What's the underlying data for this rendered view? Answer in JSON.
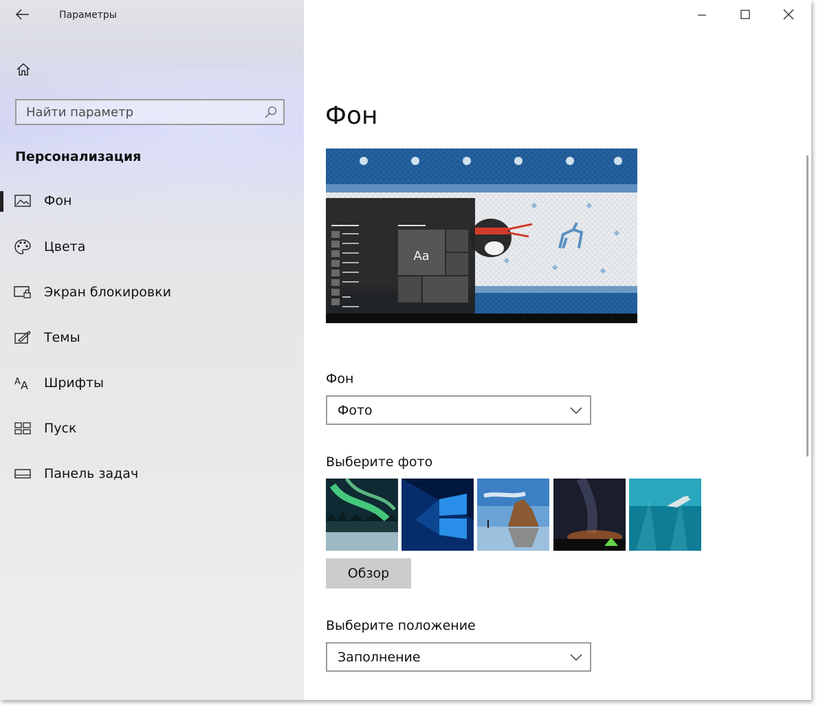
{
  "app": {
    "title": "Параметры"
  },
  "window_controls": {
    "minimize": "minimize-icon",
    "maximize": "maximize-icon",
    "close": "close-icon"
  },
  "sidebar": {
    "search_placeholder": "Найти параметр",
    "section_title": "Персонализация",
    "items": [
      {
        "label": "Фон",
        "icon": "picture-icon",
        "selected": true
      },
      {
        "label": "Цвета",
        "icon": "palette-icon",
        "selected": false
      },
      {
        "label": "Экран блокировки",
        "icon": "lock-screen-icon",
        "selected": false
      },
      {
        "label": "Темы",
        "icon": "themes-icon",
        "selected": false
      },
      {
        "label": "Шрифты",
        "icon": "fonts-icon",
        "selected": false
      },
      {
        "label": "Пуск",
        "icon": "start-icon",
        "selected": false
      },
      {
        "label": "Панель задач",
        "icon": "taskbar-icon",
        "selected": false
      }
    ]
  },
  "main": {
    "title": "Фон",
    "preview": {
      "tile_text": "Aa"
    },
    "background_label": "Фон",
    "background_value": "Фото",
    "choose_photo_label": "Выберите фото",
    "photos": [
      "aurora",
      "windows-10",
      "beach-rocks",
      "night-sky-tent",
      "underwater-swimmer"
    ],
    "browse_label": "Обзор",
    "position_label": "Выберите положение",
    "position_value": "Заполнение"
  },
  "colors": {
    "accent": "#0078d7",
    "button_bg": "#cccccc"
  }
}
